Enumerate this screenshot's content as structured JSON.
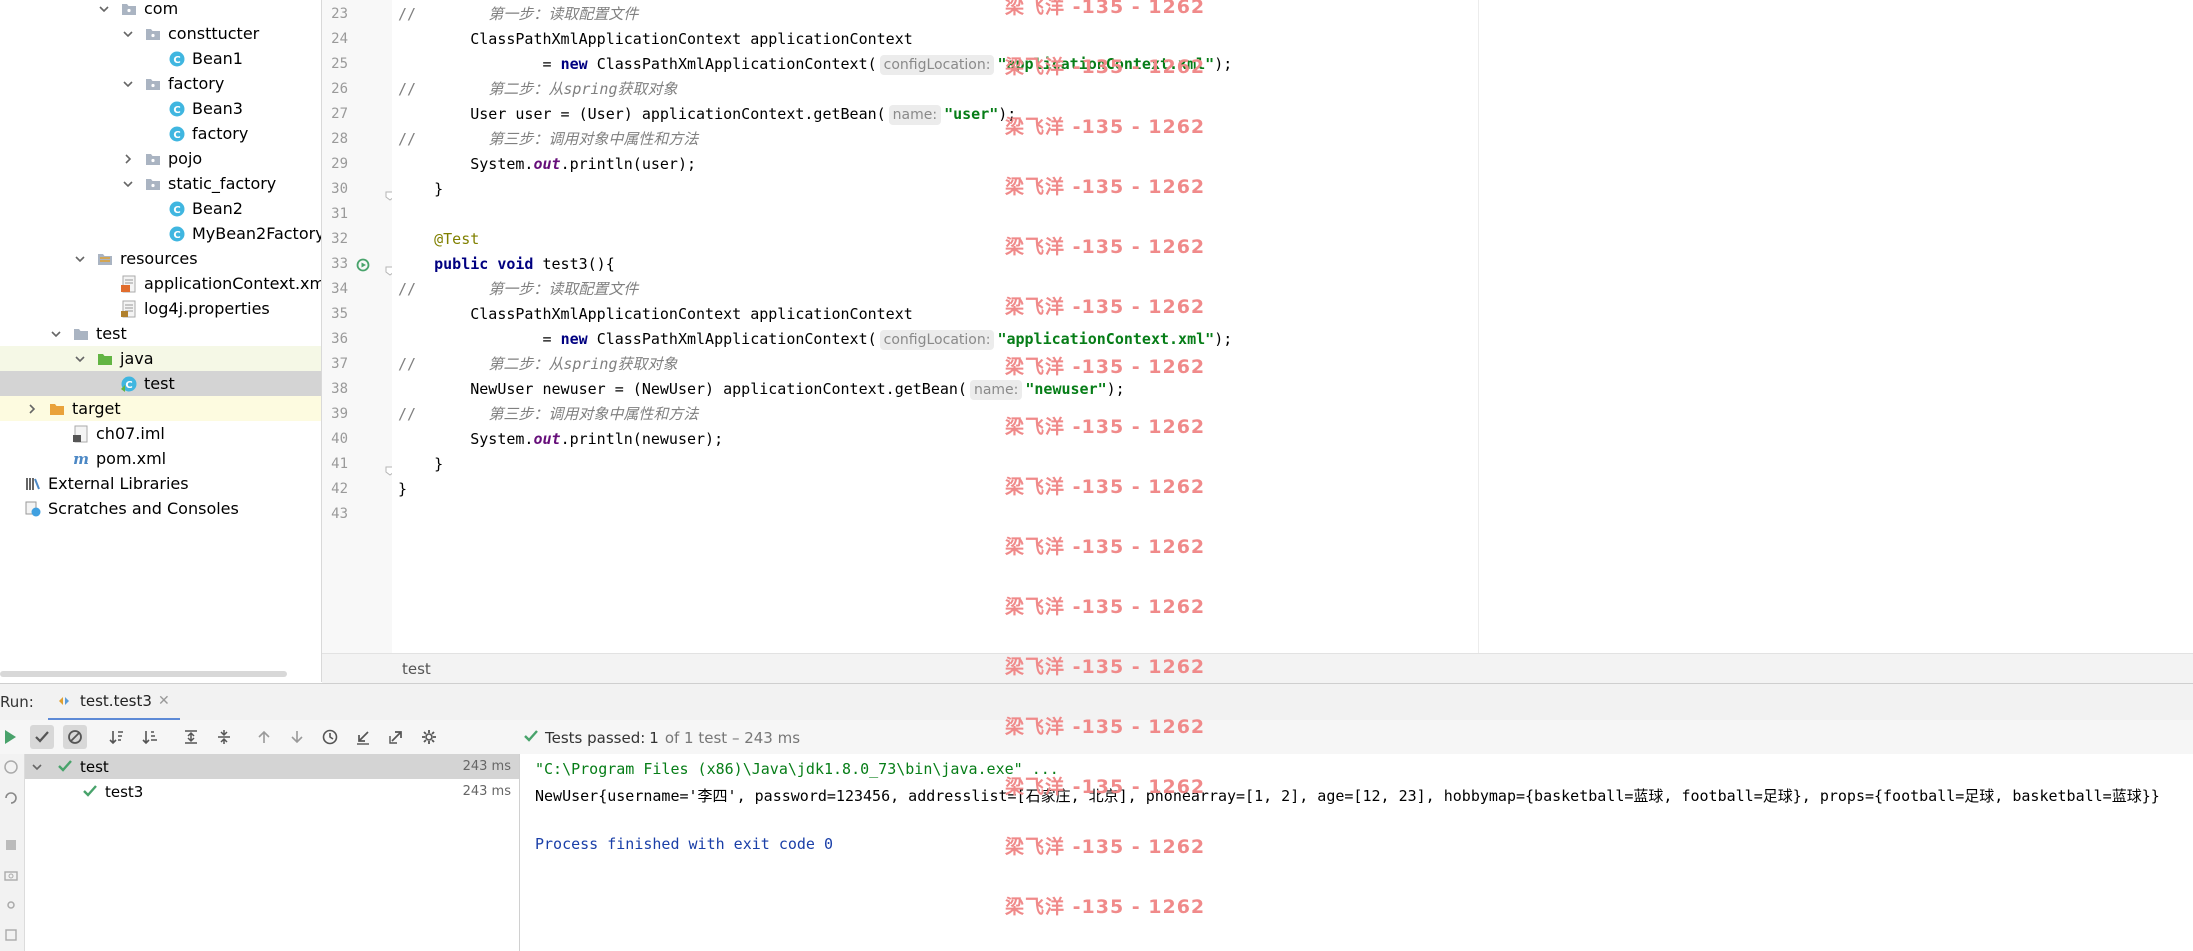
{
  "project_tree": [
    {
      "label": "com",
      "type": "package",
      "depth": 0,
      "expanded": true
    },
    {
      "label": "consttucter",
      "type": "package",
      "depth": 1,
      "expanded": true
    },
    {
      "label": "Bean1",
      "type": "class",
      "depth": 2
    },
    {
      "label": "factory",
      "type": "package",
      "depth": 1,
      "expanded": true
    },
    {
      "label": "Bean3",
      "type": "class",
      "depth": 2
    },
    {
      "label": "factory",
      "type": "class",
      "depth": 2
    },
    {
      "label": "pojo",
      "type": "package",
      "depth": 1,
      "expanded": false
    },
    {
      "label": "static_factory",
      "type": "package",
      "depth": 1,
      "expanded": true
    },
    {
      "label": "Bean2",
      "type": "class",
      "depth": 2
    },
    {
      "label": "MyBean2Factory",
      "type": "class",
      "depth": 2
    },
    {
      "label": "resources",
      "type": "resfolder",
      "depth": -1,
      "expanded": true
    },
    {
      "label": "applicationContext.xml",
      "type": "xml",
      "depth": 0
    },
    {
      "label": "log4j.properties",
      "type": "props",
      "depth": 0
    },
    {
      "label": "test",
      "type": "folder",
      "depth": -2,
      "expanded": true
    },
    {
      "label": "java",
      "type": "testsrc",
      "depth": -1,
      "expanded": true
    },
    {
      "label": "test",
      "type": "testclass",
      "depth": 0
    },
    {
      "label": "target",
      "type": "target",
      "depth": -3,
      "expanded": false
    },
    {
      "label": "ch07.iml",
      "type": "iml",
      "depth": -2
    },
    {
      "label": "pom.xml",
      "type": "maven",
      "depth": -2
    },
    {
      "label": "External Libraries",
      "type": "libs",
      "depth": -4
    },
    {
      "label": "Scratches and Consoles",
      "type": "scratch",
      "depth": -4
    }
  ],
  "editor": {
    "breadcrumb": "test",
    "lines": [
      {
        "n": "23",
        "segs": [
          [
            "cm",
            "//"
          ],
          [
            "sp",
            "        "
          ],
          [
            "cmi",
            "第一步：读取配置文件"
          ]
        ]
      },
      {
        "n": "24",
        "segs": [
          [
            "p",
            "        ClassPathXmlApplicationContext applicationContext"
          ]
        ]
      },
      {
        "n": "25",
        "segs": [
          [
            "p",
            "                = "
          ],
          [
            "kw",
            "new "
          ],
          [
            "p",
            "ClassPathXmlApplicationContext("
          ],
          [
            "hint",
            "configLocation:"
          ],
          [
            "str",
            "\"applicationContext.xml\""
          ],
          [
            "p",
            ");"
          ]
        ]
      },
      {
        "n": "26",
        "segs": [
          [
            "cm",
            "//"
          ],
          [
            "sp",
            "        "
          ],
          [
            "cmi",
            "第二步：从spring获取对象"
          ]
        ]
      },
      {
        "n": "27",
        "segs": [
          [
            "p",
            "        User user = (User) applicationContext.getBean("
          ],
          [
            "hint",
            "name:"
          ],
          [
            "str",
            "\"user\""
          ],
          [
            "p",
            ");"
          ]
        ]
      },
      {
        "n": "28",
        "segs": [
          [
            "cm",
            "//"
          ],
          [
            "sp",
            "        "
          ],
          [
            "cmi",
            "第三步：调用对象中属性和方法"
          ]
        ]
      },
      {
        "n": "29",
        "segs": [
          [
            "p",
            "        System."
          ],
          [
            "st",
            "out"
          ],
          [
            "p",
            ".println(user);"
          ]
        ]
      },
      {
        "n": "30",
        "segs": [
          [
            "p",
            "    }"
          ]
        ]
      },
      {
        "n": "31",
        "segs": []
      },
      {
        "n": "32",
        "segs": [
          [
            "ann",
            "    @Test"
          ]
        ]
      },
      {
        "n": "33",
        "segs": [
          [
            "kw",
            "    public void "
          ],
          [
            "p",
            "test3(){"
          ]
        ]
      },
      {
        "n": "34",
        "segs": [
          [
            "cm",
            "//"
          ],
          [
            "sp",
            "        "
          ],
          [
            "cmi",
            "第一步：读取配置文件"
          ]
        ]
      },
      {
        "n": "35",
        "segs": [
          [
            "p",
            "        ClassPathXmlApplicationContext applicationContext"
          ]
        ]
      },
      {
        "n": "36",
        "segs": [
          [
            "p",
            "                = "
          ],
          [
            "kw",
            "new "
          ],
          [
            "p",
            "ClassPathXmlApplicationContext("
          ],
          [
            "hint",
            "configLocation:"
          ],
          [
            "str",
            "\"applicationContext.xml\""
          ],
          [
            "p",
            ");"
          ]
        ]
      },
      {
        "n": "37",
        "segs": [
          [
            "cm",
            "//"
          ],
          [
            "sp",
            "        "
          ],
          [
            "cmi",
            "第二步：从spring获取对象"
          ]
        ]
      },
      {
        "n": "38",
        "segs": [
          [
            "p",
            "        NewUser newuser = (NewUser) applicationContext.getBean("
          ],
          [
            "hint",
            "name:"
          ],
          [
            "str",
            "\"newuser\""
          ],
          [
            "p",
            ");"
          ]
        ]
      },
      {
        "n": "39",
        "segs": [
          [
            "cm",
            "//"
          ],
          [
            "sp",
            "        "
          ],
          [
            "cmi",
            "第三步：调用对象中属性和方法"
          ]
        ]
      },
      {
        "n": "40",
        "segs": [
          [
            "p",
            "        System."
          ],
          [
            "st",
            "out"
          ],
          [
            "p",
            ".println(newuser);"
          ]
        ]
      },
      {
        "n": "41",
        "segs": [
          [
            "p",
            "    }"
          ]
        ]
      },
      {
        "n": "42",
        "segs": [
          [
            "p",
            "}"
          ]
        ]
      },
      {
        "n": "43",
        "segs": []
      }
    ]
  },
  "run": {
    "label": "Run:",
    "tab": "test.test3",
    "status_bold": "Tests passed:",
    "status_count": "1",
    "status_rest": "of 1 test – 243 ms",
    "tests": [
      {
        "name": "test",
        "time": "243 ms"
      },
      {
        "name": "test3",
        "time": "243 ms"
      }
    ],
    "console": [
      {
        "text": "\"C:\\Program Files (x86)\\Java\\jdk1.8.0_73\\bin\\java.exe\" ...",
        "color": "#067d17"
      },
      {
        "text": "NewUser{username='李四', password=123456, addresslist=[石家庄, 北京], phonearray=[1, 2], age=[12, 23], hobbymap={basketball=蓝球, football=足球}, props={football=足球, basketball=蓝球}}",
        "color": "#000000"
      },
      {
        "text": "",
        "color": "#000000"
      },
      {
        "text": "Process finished with exit code 0",
        "color": "#1a3fa8"
      }
    ]
  },
  "watermark": "梁飞洋 -135 - 1262",
  "colors": {
    "accent": "#5d8ad6",
    "pass": "#48a36b",
    "folder": "#aab4c2"
  }
}
